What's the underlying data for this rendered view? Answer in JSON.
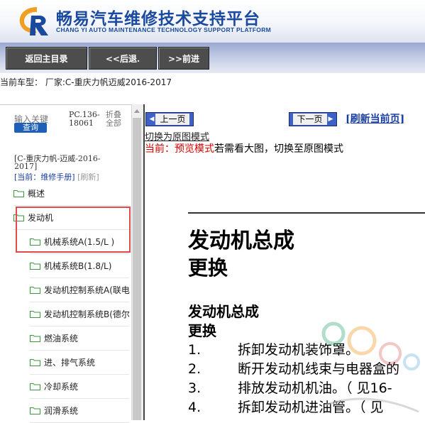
{
  "header": {
    "title": "畅易汽车维修技术支持平台",
    "subtitle": "CHANG YI AUTO MAINTENANCE TECHNOLOGY SUPPORT PLATFORM",
    "logo_icon": "cy-logo-icon",
    "brand_color": "#1a4aa0"
  },
  "nav": {
    "home": "返回主目录",
    "back": "<<后退.",
    "forward": ">>前进"
  },
  "car_model": "当前车型： 厂家:C-重庆力帆迈威2016-2017",
  "sidebar": {
    "keyword_placeholder": "输入关键",
    "query_button": "查询",
    "pc_code": "PC.136-18061",
    "fold_all": "折叠全部",
    "model": "[C-重庆力帆-迈威-2016-2017]",
    "current_prefix": "[当前：维修手册]",
    "refresh": "[刷新]",
    "items": [
      {
        "label": "概述",
        "level": 0
      },
      {
        "label": "发动机",
        "level": 0
      },
      {
        "label": "机械系统A(1.5/L )",
        "level": 1
      },
      {
        "label": "机械系统B(1.8/L)",
        "level": 1
      },
      {
        "label": "发动机控制系统A(联电",
        "level": 1
      },
      {
        "label": "发动机控制系统B(德尔",
        "level": 1
      },
      {
        "label": "燃油系统",
        "level": 1
      },
      {
        "label": "进、排气系统",
        "level": 1
      },
      {
        "label": "冷却系统",
        "level": 1
      },
      {
        "label": "润滑系统",
        "level": 1
      }
    ]
  },
  "content": {
    "prev_page": "上一页",
    "next_page": "下一页",
    "refresh_page": "[刷新当前页]",
    "switch_link": "切换为原图模式",
    "mode_prefix": "当前：预览模式",
    "mode_suffix": "若需看大图，切换至原图模式",
    "doc": {
      "title": "发动机总成",
      "title2": "更换",
      "section": "发动机总成",
      "section2": "更换",
      "steps": [
        {
          "num": "1.",
          "text": "拆卸发动机装饰罩。"
        },
        {
          "num": "2.",
          "text": "断开发动机线束与电器盒的"
        },
        {
          "num": "3.",
          "text": "排放发动机机油。（ 见16-"
        },
        {
          "num": "4.",
          "text": "拆卸发动机进油管。（ 见"
        }
      ]
    }
  },
  "colors": {
    "highlight": "#e24a4a",
    "page_button": "#3c62c8",
    "link": "#1a3ea0",
    "mode_red": "#d00000"
  }
}
